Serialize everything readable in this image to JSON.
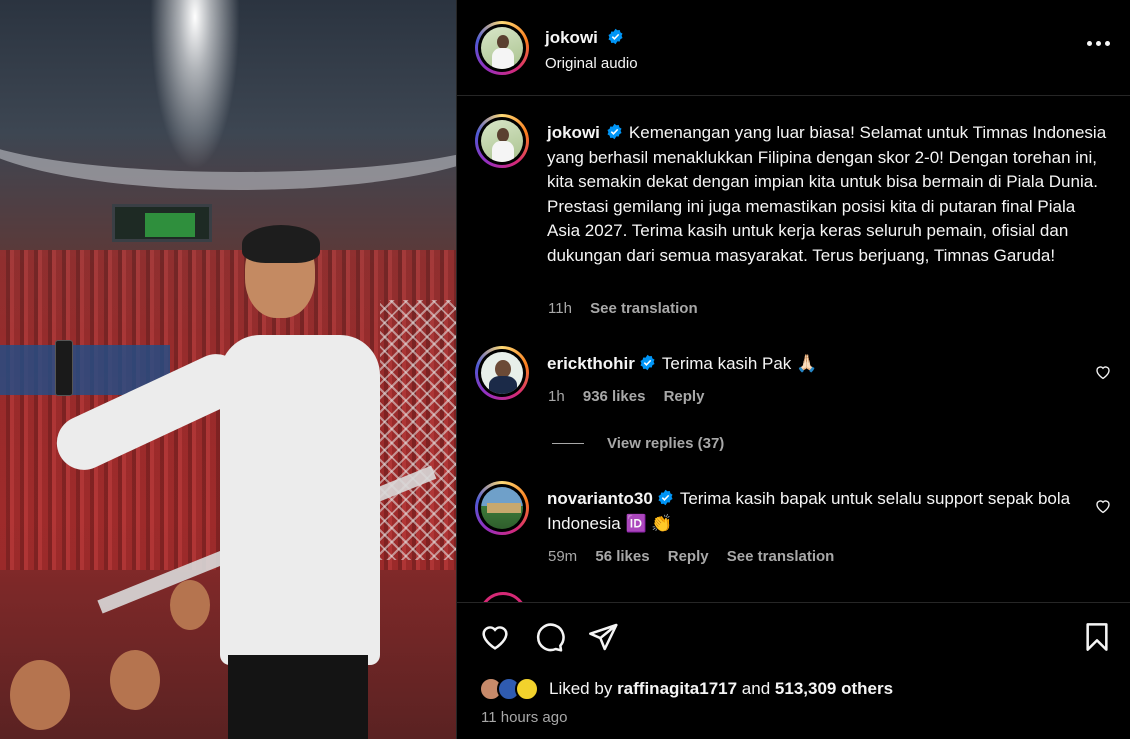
{
  "post": {
    "author": "jokowi",
    "audio": "Original audio",
    "caption": "Kemenangan yang luar biasa! Selamat untuk Timnas Indonesia yang berhasil menaklukkan Filipina dengan skor 2-0! Dengan torehan ini, kita semakin dekat dengan impian kita untuk bisa bermain di Piala Dunia. Prestasi gemilang ini juga memastikan posisi kita di putaran final Piala Asia 2027. Terima kasih untuk kerja keras seluruh pemain, ofisial dan dukungan dari semua masyarakat. Terus berjuang, Timnas Garuda!",
    "caption_time": "11h",
    "see_translation": "See translation"
  },
  "comments": [
    {
      "user": "erickthohir",
      "text": "Terima kasih Pak 🙏🏻",
      "time": "1h",
      "likes": "936 likes",
      "reply": "Reply",
      "view_replies": "View replies (37)"
    },
    {
      "user": "novarianto30",
      "text": "Terima kasih bapak untuk selalu support sepak bola Indonesia 🆔 👏",
      "time": "59m",
      "likes": "56 likes",
      "reply": "Reply",
      "see_translation": "See translation"
    }
  ],
  "footer": {
    "liked_prefix": "Liked by",
    "liked_user": "raffinagita1717",
    "liked_and": "and",
    "liked_others": "513,309 others",
    "posted_ago": "11 hours ago"
  },
  "icons": {
    "like": "heart-icon",
    "comment": "comment-icon",
    "share": "share-icon",
    "save": "bookmark-icon",
    "more": "more-options-icon",
    "verified": "verified-badge-icon"
  },
  "colors": {
    "background": "#000000",
    "text": "#f5f5f5",
    "muted": "#a8a8a8",
    "verified": "#0095f6",
    "divider": "#262626"
  }
}
